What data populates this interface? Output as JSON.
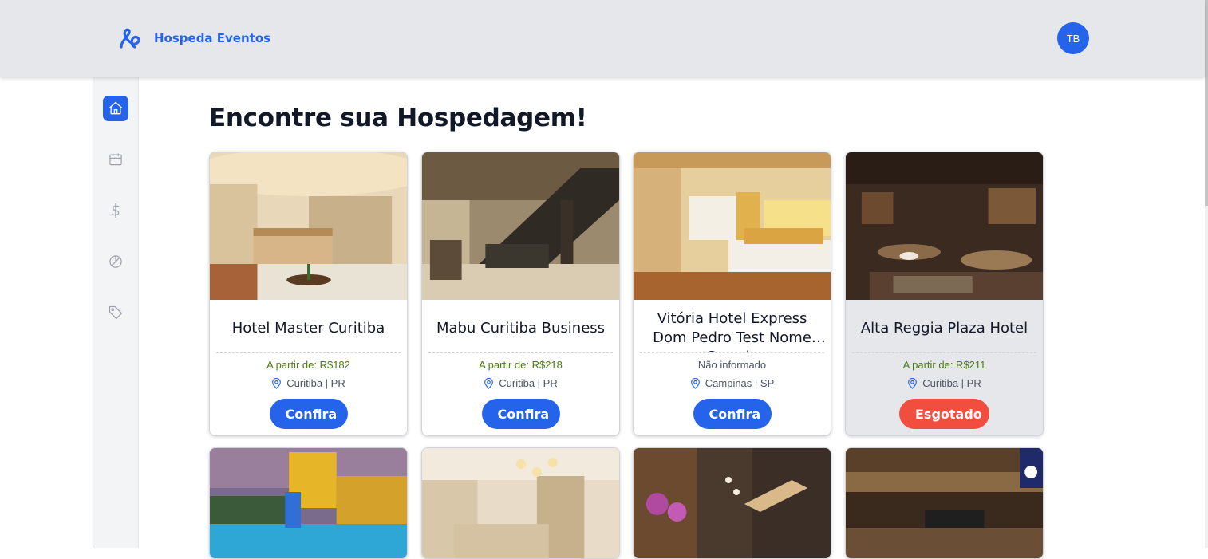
{
  "app": {
    "brand_name": "Hospeda Eventos",
    "user_initials": "TB"
  },
  "sidebar": {
    "items": [
      {
        "icon": "home-icon",
        "active": true
      },
      {
        "icon": "calendar-icon",
        "active": false
      },
      {
        "icon": "dollar-icon",
        "active": false
      },
      {
        "icon": "pie-chart-icon",
        "active": false
      },
      {
        "icon": "tag-icon",
        "active": false
      }
    ]
  },
  "main": {
    "title": "Encontre sua Hospedagem!",
    "hotels": [
      {
        "name": "Hotel Master Curitiba",
        "price": "A partir de: R$182",
        "location": "Curitiba | PR",
        "button": "Confira",
        "status": "available"
      },
      {
        "name": "Mabu Curitiba Business",
        "price": "A partir de: R$218",
        "location": "Curitiba | PR",
        "button": "Confira",
        "status": "available"
      },
      {
        "name": "Vitória Hotel Express Dom Pedro Test Nome Grande",
        "price": "Não informado",
        "location": "Campinas | SP",
        "button": "Confira",
        "status": "available"
      },
      {
        "name": "Alta Reggia Plaza Hotel",
        "price": "A partir de: R$211",
        "location": "Curitiba | PR",
        "button": "Esgotado",
        "status": "soldout"
      }
    ]
  },
  "colors": {
    "primary": "#2563eb",
    "price_green": "#4d7c0f",
    "soldout_red": "#f24e3f",
    "topbar": "#e5e7eb"
  }
}
